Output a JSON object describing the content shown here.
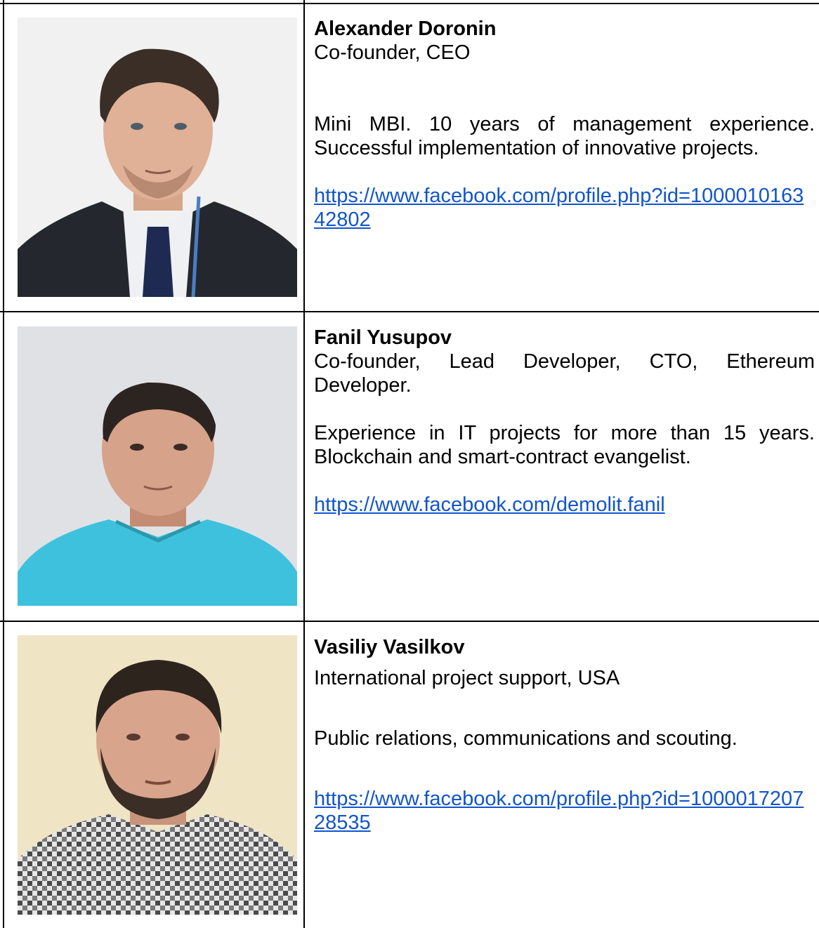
{
  "members": [
    {
      "name": "Alexander Doronin",
      "role": "Co-founder, CEO",
      "bio": "Mini MBI. 10 years of management experience. Successful implementation of innovative projects.",
      "link": "https://www.facebook.com/profile.php?id=100001016342802"
    },
    {
      "name": "Fanil Yusupov",
      "role": "Co-founder, Lead Developer, CTO, Ethereum Developer.",
      "bio": "Experience in IT projects for more than 15 years. Blockchain and smart-contract evangelist.",
      "link": "https://www.facebook.com/demolit.fanil"
    },
    {
      "name": "Vasiliy Vasilkov",
      "role": "International project support, USA",
      "bio": "Public relations, communications and scouting.",
      "link": "https://www.facebook.com/profile.php?id=100001720728535"
    }
  ],
  "colors": {
    "link": "#1155cc",
    "border": "#000000"
  }
}
